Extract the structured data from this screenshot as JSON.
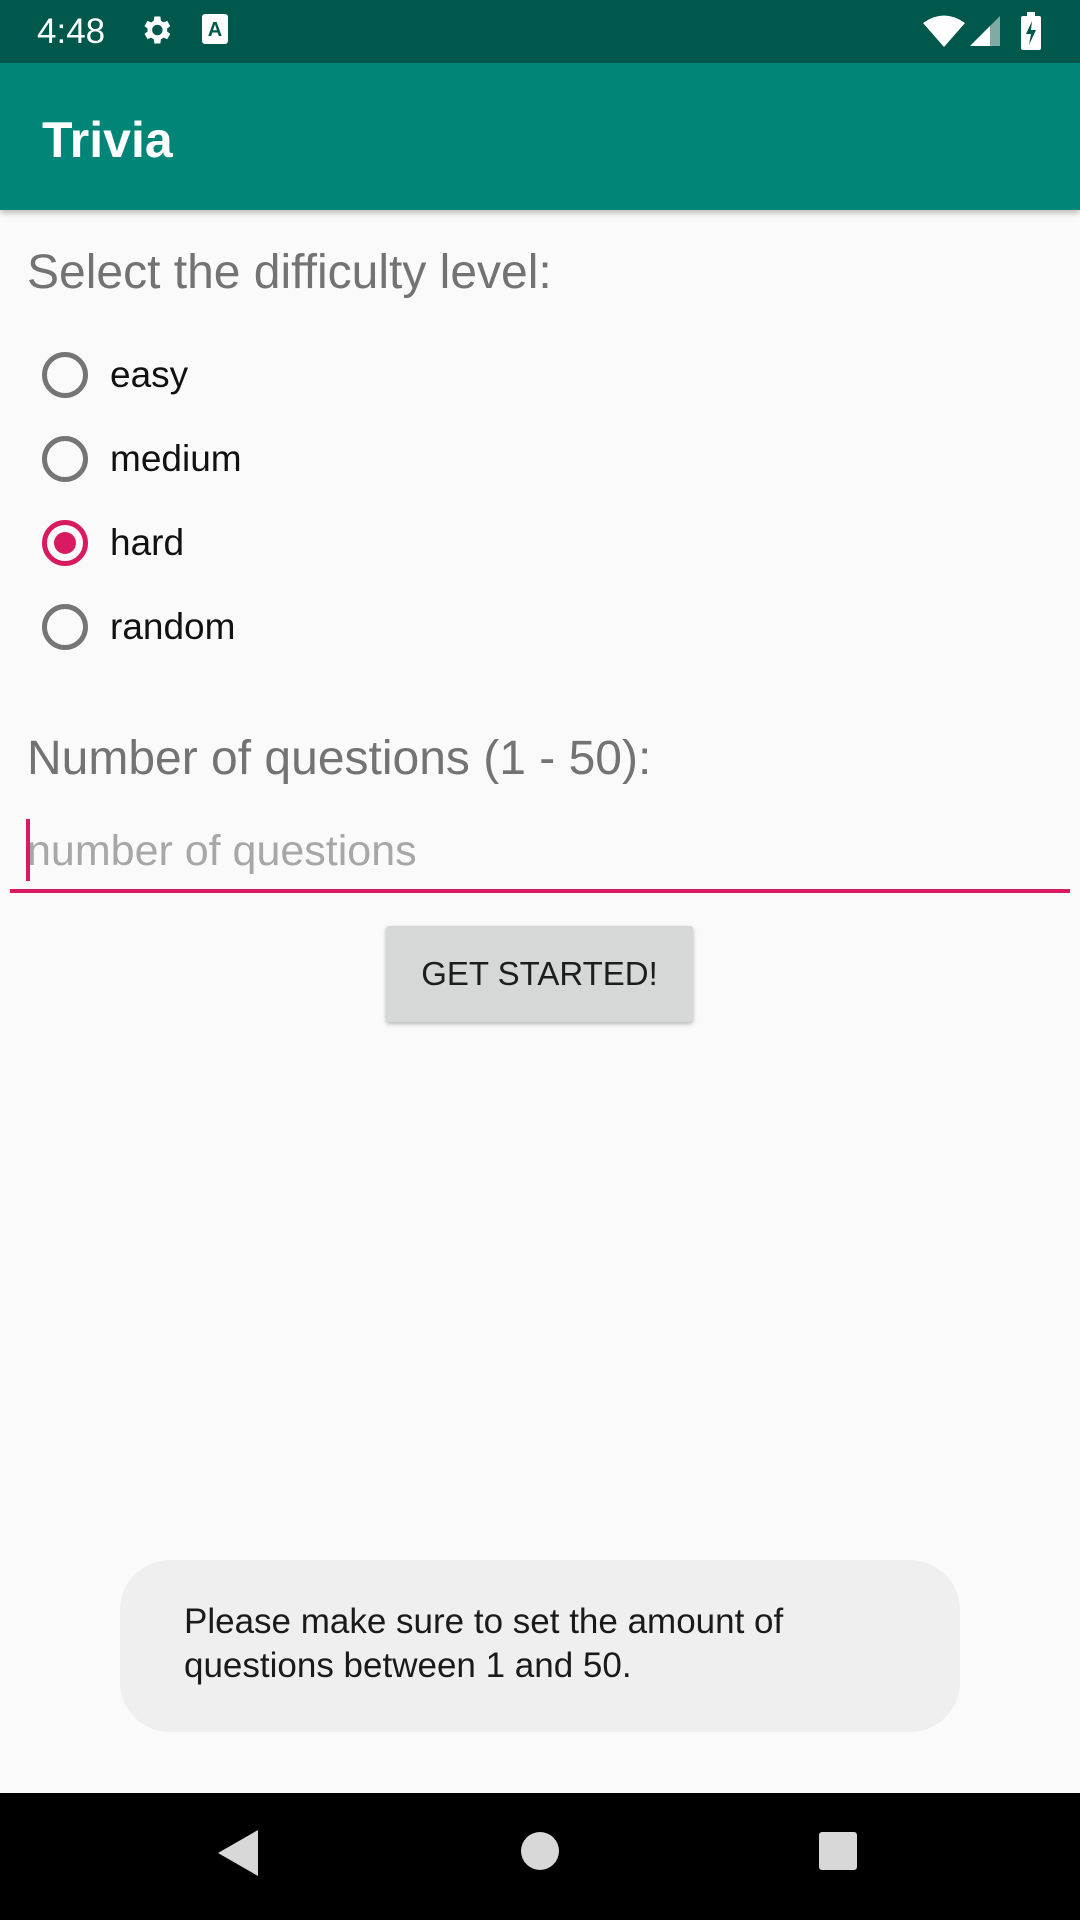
{
  "status_bar": {
    "time": "4:48",
    "left_icons": [
      "gear-icon",
      "a-badge-icon"
    ],
    "right_icons": [
      "wifi-icon",
      "signal-icon",
      "battery-charging-icon"
    ]
  },
  "app_bar": {
    "title": "Trivia"
  },
  "difficulty": {
    "label": "Select the difficulty level:",
    "options": [
      {
        "label": "easy",
        "checked": false
      },
      {
        "label": "medium",
        "checked": false
      },
      {
        "label": "hard",
        "checked": true
      },
      {
        "label": "random",
        "checked": false
      }
    ]
  },
  "questions": {
    "label": "Number of questions (1 - 50):",
    "placeholder": "number of questions",
    "value": ""
  },
  "start_button": {
    "label": "GET STARTED!"
  },
  "toast": {
    "message": "Please make sure to set the amount of questions between 1 and 50."
  },
  "nav_bar": {
    "buttons": [
      "back-icon",
      "home-icon",
      "recents-icon"
    ]
  },
  "colors": {
    "primary": "#008577",
    "primary_dark": "#00574b",
    "accent": "#d81b60"
  }
}
